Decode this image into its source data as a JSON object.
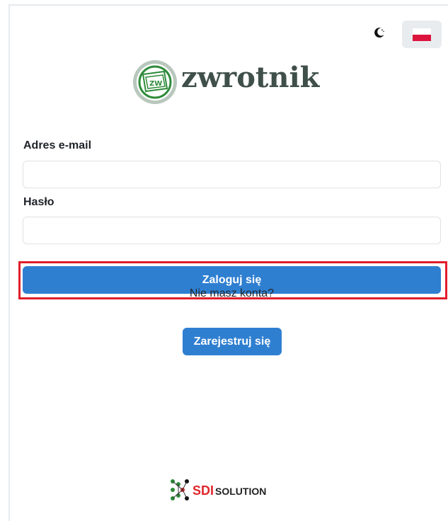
{
  "header": {
    "theme_toggle_icon": "moon-icon",
    "language_flag": "poland-flag-icon"
  },
  "brand": {
    "logo_text": "zwrotnik",
    "emblem_text": "ZW"
  },
  "form": {
    "email_label": "Adres e-mail",
    "email_value": "",
    "email_placeholder": "",
    "password_label": "Hasło",
    "password_value": "",
    "password_placeholder": "",
    "login_button": "Zaloguj się",
    "no_account_text": "Nie masz konta?",
    "register_button": "Zarejestruj się"
  },
  "footer": {
    "company_part1": "SDI",
    "company_part2": "SOLUTION"
  },
  "colors": {
    "primary_button": "#2f7fd1",
    "highlight_border": "#e11d2a",
    "logo_green": "#2e8b3a",
    "sdi_red": "#e0262b"
  }
}
